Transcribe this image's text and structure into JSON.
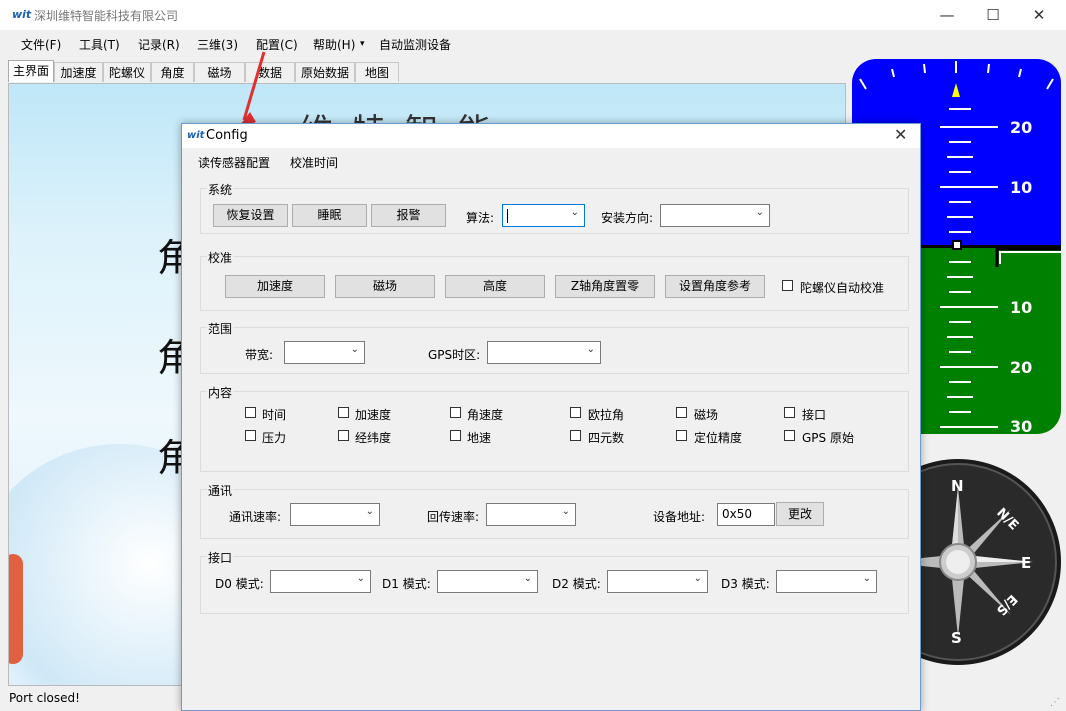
{
  "app": {
    "title": "深圳维特智能科技有限公司",
    "logo_text": "wit"
  },
  "window_controls": {
    "minimize": "—",
    "maximize": "☐",
    "close": "✕"
  },
  "menu": [
    "文件(F)",
    "工具(T)",
    "记录(R)",
    "三维(3)",
    "配置(C)",
    "帮助(H)",
    "▾",
    "自动监测设备"
  ],
  "tabs": [
    "主界面",
    "加速度",
    "陀螺仪",
    "角度",
    "磁场",
    "数据",
    "原始数据",
    "地图"
  ],
  "main": {
    "banner_heading": "维  特  智  能",
    "angle_glyphs": [
      "角",
      "角",
      "角"
    ]
  },
  "status_bar": {
    "text": "Port closed!"
  },
  "attitude_indicator": {
    "pitch_labels": [
      "20",
      "10",
      "10",
      "20",
      "30"
    ],
    "colors": {
      "sky": "#0000ff",
      "ground": "#008000",
      "pointer": "#ffff00"
    }
  },
  "compass": {
    "N": "N",
    "NE": "N/E",
    "E": "E",
    "SE": "E/S",
    "S": "S"
  },
  "config": {
    "title": "Config",
    "close": "✕",
    "menu": [
      "读传感器配置",
      "校准时间"
    ],
    "system": {
      "title": "系统",
      "buttons": [
        "恢复设置",
        "睡眠",
        "报警"
      ],
      "algorithm_label": "算法:",
      "algorithm_value": "",
      "install_label": "安装方向:",
      "install_value": ""
    },
    "calibration": {
      "title": "校准",
      "buttons": [
        "加速度",
        "磁场",
        "高度",
        "Z轴角度置零",
        "设置角度参考"
      ],
      "gyro_auto_label": "陀螺仪自动校准",
      "gyro_auto_checked": false
    },
    "range": {
      "title": "范围",
      "bandwidth_label": "带宽:",
      "bandwidth_value": "",
      "gps_tz_label": "GPS时区:",
      "gps_tz_value": ""
    },
    "content": {
      "title": "内容",
      "items": [
        {
          "label": "时间",
          "checked": false
        },
        {
          "label": "加速度",
          "checked": false
        },
        {
          "label": "角速度",
          "checked": false
        },
        {
          "label": "欧拉角",
          "checked": false
        },
        {
          "label": "磁场",
          "checked": false
        },
        {
          "label": "接口",
          "checked": false
        },
        {
          "label": "压力",
          "checked": false
        },
        {
          "label": "经纬度",
          "checked": false
        },
        {
          "label": "地速",
          "checked": false
        },
        {
          "label": "四元数",
          "checked": false
        },
        {
          "label": "定位精度",
          "checked": false
        },
        {
          "label": "GPS 原始",
          "checked": false
        }
      ]
    },
    "comm": {
      "title": "通讯",
      "baud_label": "通讯速率:",
      "baud_value": "",
      "return_rate_label": "回传速率:",
      "return_rate_value": "",
      "address_label": "设备地址:",
      "address_value": "0x50",
      "change_button": "更改"
    },
    "ports": {
      "title": "接口",
      "modes": [
        {
          "label": "D0 模式:",
          "value": ""
        },
        {
          "label": "D1 模式:",
          "value": ""
        },
        {
          "label": "D2 模式:",
          "value": ""
        },
        {
          "label": "D3 模式:",
          "value": ""
        }
      ]
    }
  }
}
